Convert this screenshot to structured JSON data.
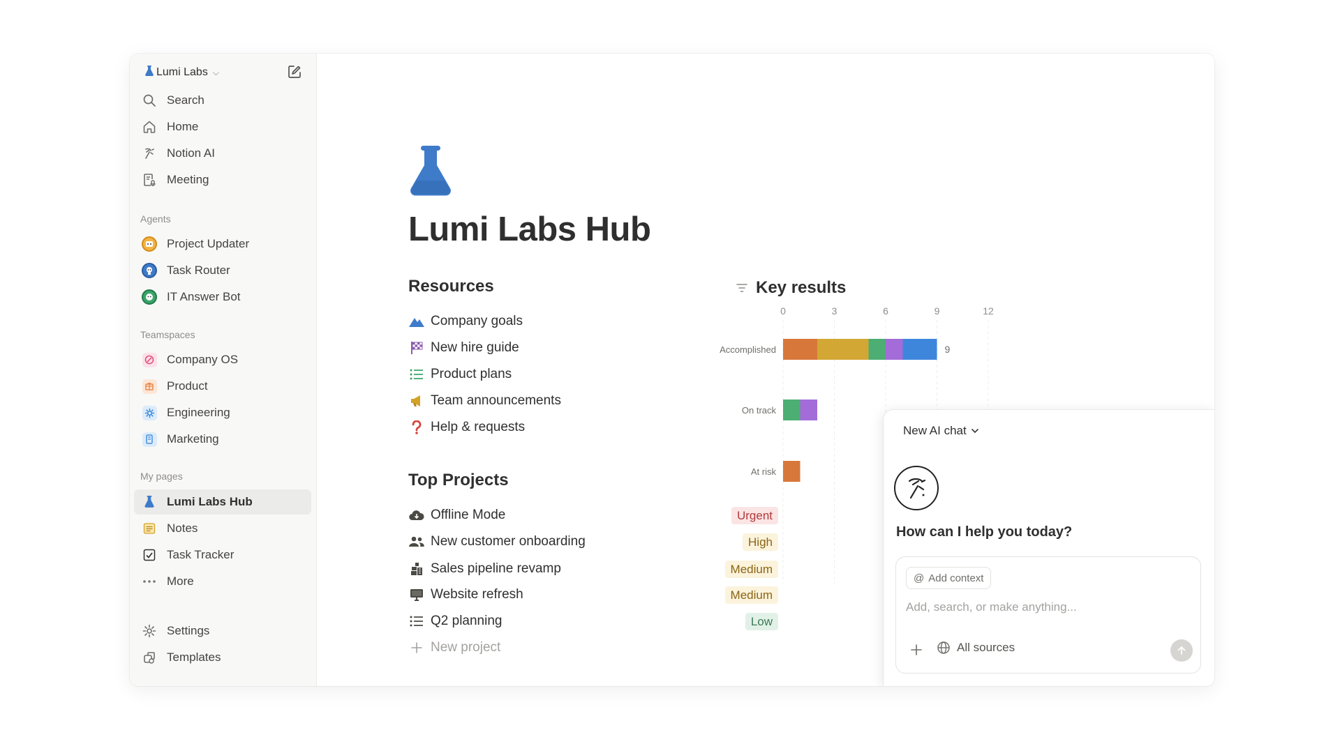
{
  "workspace": {
    "name": "Lumi Labs",
    "icon": "flask-icon"
  },
  "sidebar": {
    "nav": [
      {
        "label": "Search",
        "icon": "search-icon"
      },
      {
        "label": "Home",
        "icon": "home-icon"
      },
      {
        "label": "Notion AI",
        "icon": "notion-ai-icon"
      },
      {
        "label": "Meeting",
        "icon": "meeting-icon"
      }
    ],
    "agents_label": "Agents",
    "agents": [
      {
        "label": "Project Updater",
        "icon": "project-updater-avatar",
        "color": "#e9a23b"
      },
      {
        "label": "Task Router",
        "icon": "task-router-avatar",
        "color": "#3e7bc9"
      },
      {
        "label": "IT Answer Bot",
        "icon": "it-answer-bot-avatar",
        "color": "#3aa56a"
      }
    ],
    "teamspaces_label": "Teamspaces",
    "teamspaces": [
      {
        "label": "Company OS",
        "icon": "company-os-icon",
        "color": "#e0557d"
      },
      {
        "label": "Product",
        "icon": "product-icon",
        "color": "#e8874a"
      },
      {
        "label": "Engineering",
        "icon": "engineering-icon",
        "color": "#2f86d6"
      },
      {
        "label": "Marketing",
        "icon": "marketing-icon",
        "color": "#4a90d9"
      }
    ],
    "my_pages_label": "My pages",
    "my_pages": [
      {
        "label": "Lumi Labs Hub",
        "icon": "flask-icon",
        "active": true
      },
      {
        "label": "Notes",
        "icon": "notes-icon"
      },
      {
        "label": "Task Tracker",
        "icon": "checkbox-icon"
      },
      {
        "label": "More",
        "icon": "more-icon"
      }
    ],
    "bottom": [
      {
        "label": "Settings",
        "icon": "gear-icon"
      },
      {
        "label": "Templates",
        "icon": "templates-icon"
      }
    ]
  },
  "page": {
    "title": "Lumi Labs Hub",
    "icon": "flask-icon",
    "resources_heading": "Resources",
    "resources": [
      {
        "label": "Company goals",
        "icon": "mountain-icon"
      },
      {
        "label": "New hire guide",
        "icon": "checkered-flag-icon"
      },
      {
        "label": "Product plans",
        "icon": "list-icon"
      },
      {
        "label": "Team announcements",
        "icon": "megaphone-icon"
      },
      {
        "label": "Help & requests",
        "icon": "question-icon"
      }
    ],
    "projects_heading": "Top Projects",
    "projects": [
      {
        "label": "Offline Mode",
        "icon": "cloud-icon",
        "priority": "Urgent"
      },
      {
        "label": "New customer onboarding",
        "icon": "people-icon",
        "priority": "High"
      },
      {
        "label": "Sales pipeline revamp",
        "icon": "pipeline-icon",
        "priority": "Medium"
      },
      {
        "label": "Website refresh",
        "icon": "monitor-icon",
        "priority": "Medium"
      },
      {
        "label": "Q2 planning",
        "icon": "list-icon",
        "priority": "Low"
      }
    ],
    "new_project_label": "New project",
    "priority_colors": {
      "Urgent": {
        "bg": "#fbe4e4",
        "fg": "#b23a3a"
      },
      "High": {
        "bg": "#fbf3db",
        "fg": "#8a6414"
      },
      "Medium": {
        "bg": "#fbf3db",
        "fg": "#8a6414"
      },
      "Low": {
        "bg": "#e2f1e8",
        "fg": "#3c7a55"
      }
    }
  },
  "key_results": {
    "title": "Key results",
    "icon": "filter-icon"
  },
  "chart_data": {
    "type": "bar",
    "orientation": "horizontal",
    "stacked": true,
    "title": "Key results",
    "categories": [
      "Accomplished",
      "On track",
      "At risk"
    ],
    "x_ticks": [
      0,
      3,
      6,
      9,
      12
    ],
    "xlim": [
      0,
      12
    ],
    "totals_label": {
      "Accomplished": 9
    },
    "series_colors": [
      "#d8773a",
      "#d3a733",
      "#4cae73",
      "#a36cd8",
      "#3e86dc"
    ],
    "segments": {
      "Accomplished": [
        2,
        3,
        1,
        1,
        2
      ],
      "On track": [
        0,
        0,
        1,
        1,
        0
      ],
      "At risk": [
        1,
        0,
        0,
        0,
        0
      ]
    },
    "grid": true
  },
  "chat": {
    "title": "New AI chat",
    "greeting": "How can I help you today?",
    "add_context": "Add context",
    "placeholder": "Add, search, or make anything...",
    "sources": "All sources"
  }
}
